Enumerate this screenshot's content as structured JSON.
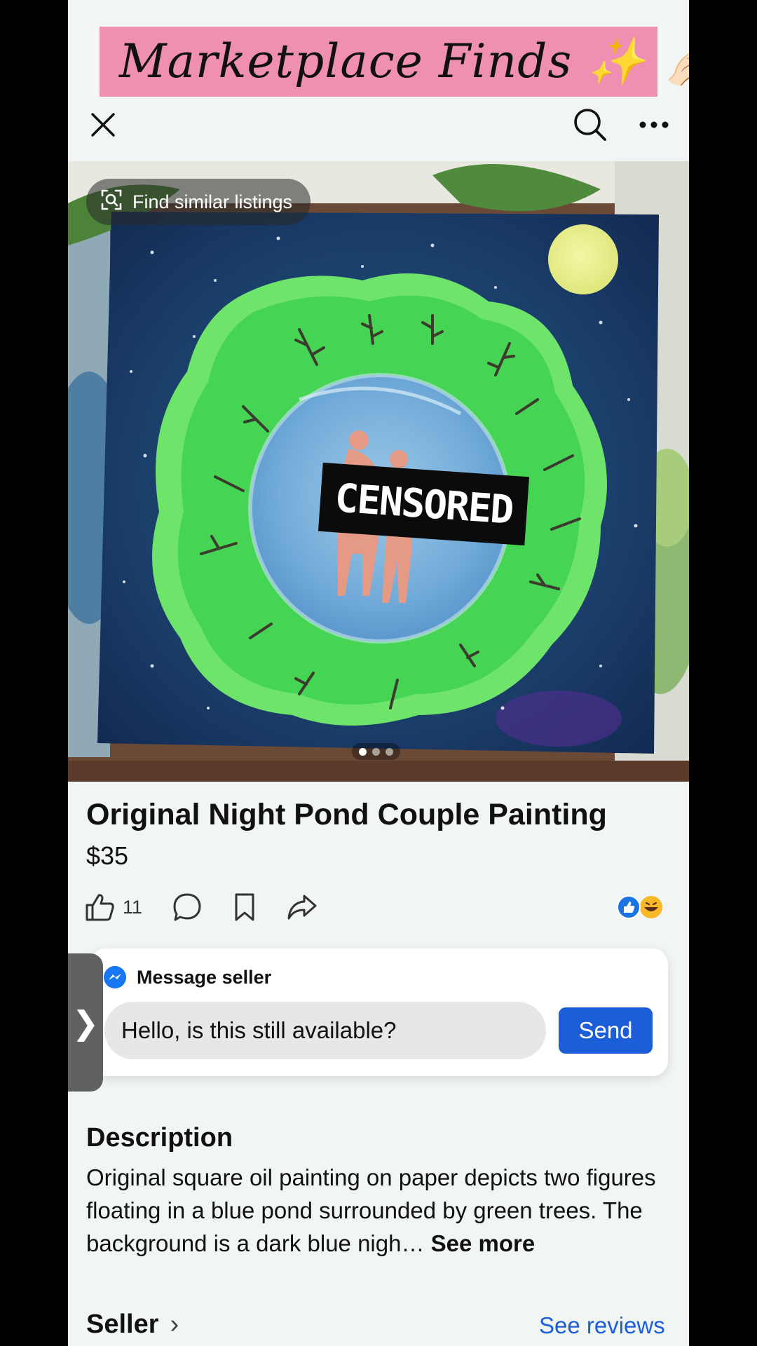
{
  "banner": {
    "text": "Marketplace Finds ✨ 🤌🏻"
  },
  "topbar": {
    "close_icon": "close-icon",
    "search_icon": "search-icon",
    "more_icon": "more-icon"
  },
  "image": {
    "find_similar_label": "Find similar listings",
    "censor_label": "CENSORED",
    "page_count": 3,
    "page_active": 1
  },
  "listing": {
    "title": "Original Night Pond Couple Painting",
    "price": "$35"
  },
  "actions": {
    "like_count": "11"
  },
  "message": {
    "header": "Message seller",
    "input_value": "Hello, is this still available?",
    "send_label": "Send"
  },
  "side_tab": {
    "glyph": "❯"
  },
  "description": {
    "heading": "Description",
    "text": "Original  square oil painting on paper depicts two figures floating in a blue pond surrounded by green trees. The background is a dark blue nigh…",
    "see_more": "See more"
  },
  "seller": {
    "label": "Seller",
    "chevron": "›",
    "see_reviews": "See reviews"
  },
  "colors": {
    "accent": "#1b5ed8",
    "banner": "#ef8fb2"
  }
}
